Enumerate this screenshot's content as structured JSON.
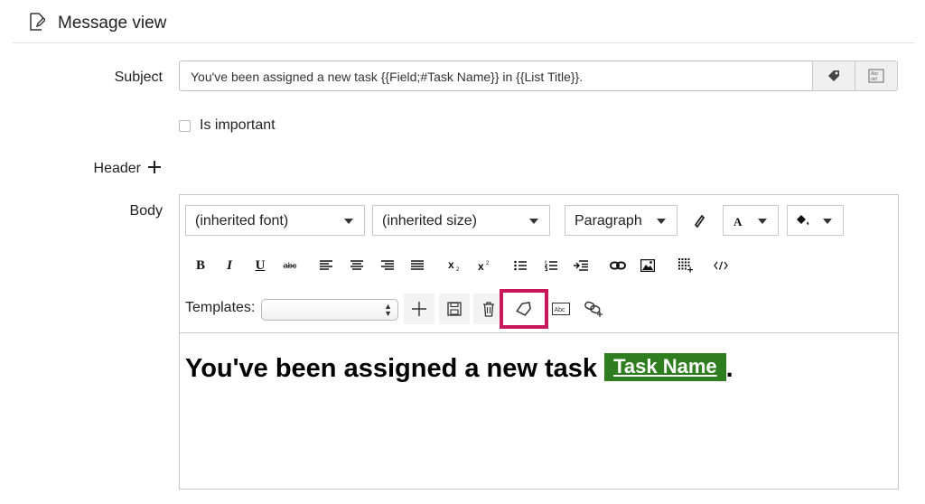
{
  "header": {
    "title": "Message view",
    "icon": "edit-document-icon"
  },
  "form": {
    "subject_label": "Subject",
    "subject_value": "You've been assigned a new task {{Field;#Task Name}} in {{List Title}}.",
    "is_important_label": "Is important",
    "header_label": "Header",
    "body_label": "Body"
  },
  "toolbar": {
    "font": "(inherited font)",
    "size": "(inherited size)",
    "format": "Paragraph",
    "bold": "B",
    "italic": "I",
    "underline": "U",
    "strike": "abc",
    "templates_label": "Templates:"
  },
  "body": {
    "text": "You've been assigned a new task",
    "field_chip": "Task Name",
    "trailing": "."
  },
  "colors": {
    "chip": "#2e7d1e",
    "highlight": "#c8185a"
  }
}
